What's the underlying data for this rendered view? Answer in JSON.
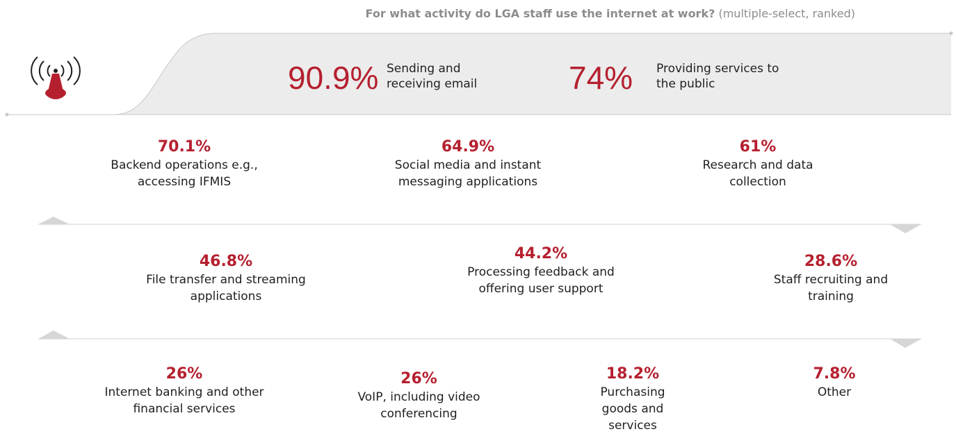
{
  "title": {
    "bold": "For what activity do LGA staff use the internet at work?",
    "rest": "(multiple-select, ranked)"
  },
  "colors": {
    "accent": "#b5202f",
    "band": "#ececec",
    "rule": "#cccccc",
    "triangle": "#d6d6d6",
    "muted": "#8c8c8c"
  },
  "icon": "wifi-signal-tower-icon",
  "chart_data": {
    "type": "table",
    "title": "For what activity do LGA staff use the internet at work? (multiple-select, ranked)",
    "items": [
      {
        "value": "90.9%",
        "label": "Sending and receiving email"
      },
      {
        "value": "74%",
        "label": "Providing services to the public"
      },
      {
        "value": "70.1%",
        "label": "Backend operations e.g., accessing IFMIS"
      },
      {
        "value": "64.9%",
        "label": "Social media and instant messaging applications"
      },
      {
        "value": "61%",
        "label": "Research and data collection"
      },
      {
        "value": "46.8%",
        "label": "File transfer and streaming applications"
      },
      {
        "value": "44.2%",
        "label": "Processing feedback and offering user support"
      },
      {
        "value": "28.6%",
        "label": "Staff recruiting and training"
      },
      {
        "value": "26%",
        "label": "Internet banking and other financial services"
      },
      {
        "value": "26%",
        "label": "VoIP, including video conferencing"
      },
      {
        "value": "18.2%",
        "label": "Purchasing goods and services"
      },
      {
        "value": "7.8%",
        "label": "Other"
      }
    ]
  }
}
